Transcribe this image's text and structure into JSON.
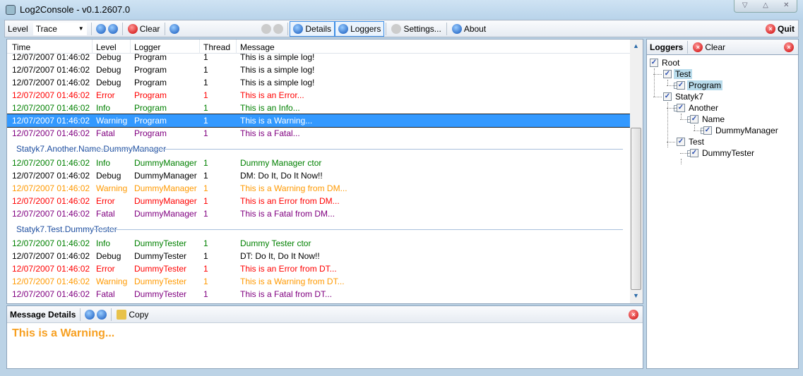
{
  "window": {
    "title": "Log2Console - v0.1.2607.0"
  },
  "toolbar": {
    "level_label": "Level",
    "level_value": "Trace",
    "clear": "Clear",
    "details": "Details",
    "loggers": "Loggers",
    "settings": "Settings...",
    "about": "About",
    "quit": "Quit"
  },
  "colors": {
    "Debug": "#000000",
    "Error": "#ff0000",
    "Info": "#008000",
    "Warning": "#ff9900",
    "Fatal": "#800080"
  },
  "columns": [
    "Time",
    "Level",
    "Logger",
    "Thread",
    "Message"
  ],
  "groups": [
    {
      "header": "",
      "rows": [
        {
          "time": "12/07/2007 01:46:02",
          "level": "Debug",
          "logger": "Program",
          "thread": "1",
          "message": "This is a simple log!"
        },
        {
          "time": "12/07/2007 01:46:02",
          "level": "Debug",
          "logger": "Program",
          "thread": "1",
          "message": "This is a simple log!"
        },
        {
          "time": "12/07/2007 01:46:02",
          "level": "Debug",
          "logger": "Program",
          "thread": "1",
          "message": "This is a simple log!"
        },
        {
          "time": "12/07/2007 01:46:02",
          "level": "Error",
          "logger": "Program",
          "thread": "1",
          "message": "This is an Error..."
        },
        {
          "time": "12/07/2007 01:46:02",
          "level": "Info",
          "logger": "Program",
          "thread": "1",
          "message": "This is an Info..."
        },
        {
          "time": "12/07/2007 01:46:02",
          "level": "Warning",
          "logger": "Program",
          "thread": "1",
          "message": "This is a Warning...",
          "selected": true
        },
        {
          "time": "12/07/2007 01:46:02",
          "level": "Fatal",
          "logger": "Program",
          "thread": "1",
          "message": "This is a Fatal..."
        }
      ]
    },
    {
      "header": "Statyk7.Another.Name.DummyManager",
      "rows": [
        {
          "time": "12/07/2007 01:46:02",
          "level": "Info",
          "logger": "DummyManager",
          "thread": "1",
          "message": "Dummy Manager ctor"
        },
        {
          "time": "12/07/2007 01:46:02",
          "level": "Debug",
          "logger": "DummyManager",
          "thread": "1",
          "message": "DM: Do It, Do It Now!!"
        },
        {
          "time": "12/07/2007 01:46:02",
          "level": "Warning",
          "logger": "DummyManager",
          "thread": "1",
          "message": "This is a Warning from DM..."
        },
        {
          "time": "12/07/2007 01:46:02",
          "level": "Error",
          "logger": "DummyManager",
          "thread": "1",
          "message": "This is an Error from DM..."
        },
        {
          "time": "12/07/2007 01:46:02",
          "level": "Fatal",
          "logger": "DummyManager",
          "thread": "1",
          "message": "This is a Fatal from DM..."
        }
      ]
    },
    {
      "header": "Statyk7.Test.DummyTester",
      "rows": [
        {
          "time": "12/07/2007 01:46:02",
          "level": "Info",
          "logger": "DummyTester",
          "thread": "1",
          "message": "Dummy Tester ctor"
        },
        {
          "time": "12/07/2007 01:46:02",
          "level": "Debug",
          "logger": "DummyTester",
          "thread": "1",
          "message": "DT: Do It, Do It Now!!"
        },
        {
          "time": "12/07/2007 01:46:02",
          "level": "Error",
          "logger": "DummyTester",
          "thread": "1",
          "message": "This is an Error from DT..."
        },
        {
          "time": "12/07/2007 01:46:02",
          "level": "Warning",
          "logger": "DummyTester",
          "thread": "1",
          "message": "This is a Warning from DT..."
        },
        {
          "time": "12/07/2007 01:46:02",
          "level": "Fatal",
          "logger": "DummyTester",
          "thread": "1",
          "message": "This is a Fatal from DT..."
        }
      ]
    }
  ],
  "details": {
    "title": "Message Details",
    "copy": "Copy",
    "message": "This is a Warning..."
  },
  "loggers": {
    "title": "Loggers",
    "clear": "Clear",
    "tree": [
      {
        "label": "Root",
        "depth": 0
      },
      {
        "label": "Test",
        "depth": 1,
        "highlight": true
      },
      {
        "label": "Program",
        "depth": 2,
        "highlight": true
      },
      {
        "label": "Statyk7",
        "depth": 1
      },
      {
        "label": "Another",
        "depth": 2
      },
      {
        "label": "Name",
        "depth": 3
      },
      {
        "label": "DummyManager",
        "depth": 4
      },
      {
        "label": "Test",
        "depth": 2
      },
      {
        "label": "DummyTester",
        "depth": 3
      }
    ]
  }
}
